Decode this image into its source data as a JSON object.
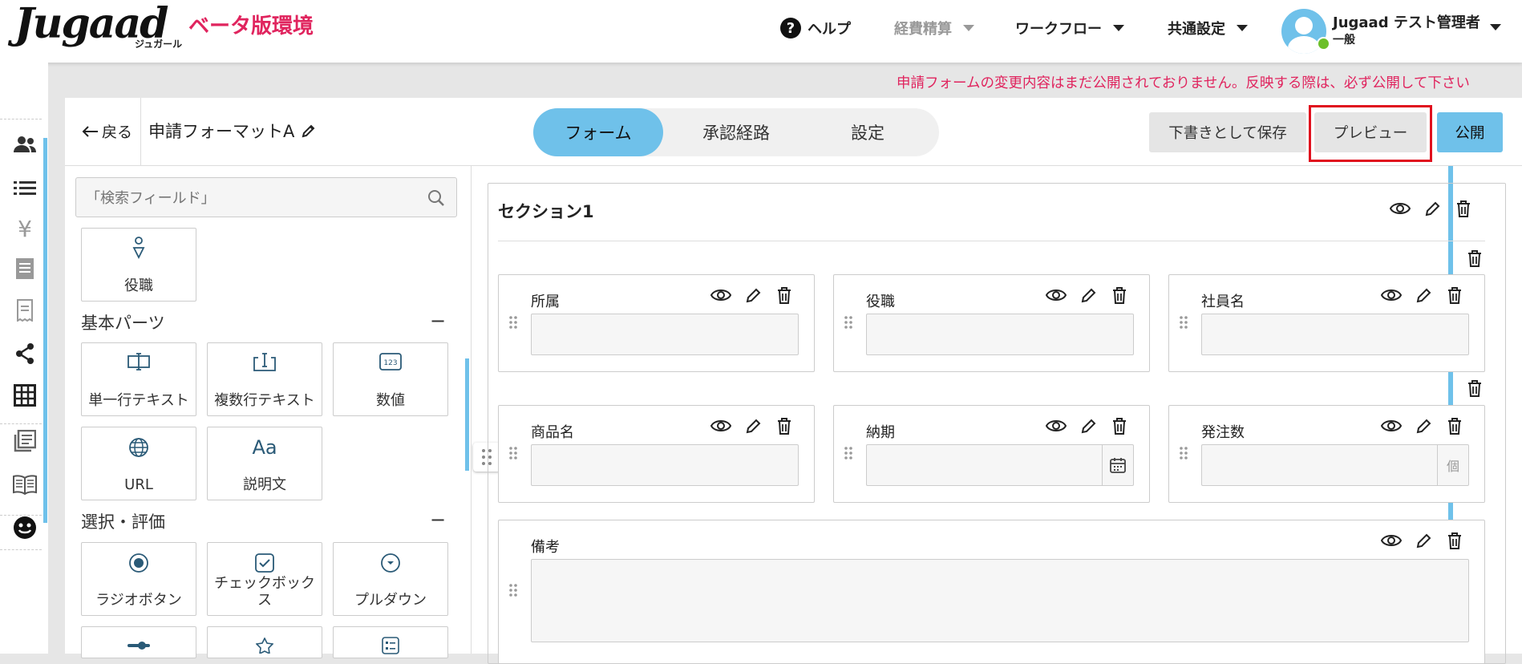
{
  "header": {
    "logo": "Jugaad",
    "logo_sub": "ジュガール",
    "beta_label": "ベータ版環境",
    "nav": {
      "help": "ヘルプ",
      "expense": "経費精算",
      "workflow": "ワークフロー",
      "common_settings": "共通設定"
    },
    "user": {
      "name": "Jugaad テスト管理者",
      "role": "一般"
    }
  },
  "warning": "申請フォームの変更内容はまだ公開されておりません。反映する際は、必ず公開して下さい",
  "toolbar": {
    "back": "戻る",
    "form_name": "申請フォーマットA",
    "tabs": [
      "フォーム",
      "承認経路",
      "設定"
    ],
    "save_draft": "下書きとして保存",
    "preview": "プレビュー",
    "publish": "公開"
  },
  "palette": {
    "search_placeholder": "「検索フィールド」",
    "top_item": "役職",
    "groups": [
      {
        "title": "基本パーツ",
        "items": [
          "単一行テキスト",
          "複数行テキスト",
          "数値",
          "URL",
          "説明文"
        ]
      },
      {
        "title": "選択・評価",
        "items": [
          "ラジオボタン",
          "チェックボックス",
          "プルダウン"
        ]
      }
    ],
    "collapse_symbol": "−",
    "number_icon_text": "123",
    "text_icon_text": "Aa"
  },
  "canvas": {
    "section_title": "セクション1",
    "fields": [
      {
        "label": "所属"
      },
      {
        "label": "役職"
      },
      {
        "label": "社員名"
      },
      {
        "label": "商品名"
      },
      {
        "label": "納期"
      },
      {
        "label": "発注数",
        "unit": "個"
      },
      {
        "label": "備考"
      }
    ]
  },
  "colors": {
    "accent": "#6fc1ea",
    "brand_red": "#e0245e",
    "highlight": "#e0101e"
  }
}
